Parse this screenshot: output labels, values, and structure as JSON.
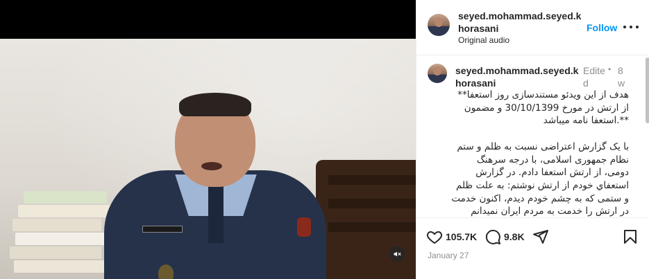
{
  "post": {
    "username": "seyed.mohammad.seyed.khorasani",
    "audio_label": "Original audio",
    "follow_label": "Follow",
    "more_icon": "more-horizontal-icon"
  },
  "caption": {
    "username": "seyed.mohammad.seyed.khorasani",
    "edited_label": "Edited",
    "separator": "•",
    "time_ago": "8w",
    "text": "هدف از این ویدئو مستندسازی روز استعفا** از ارتش در مورخ 30/10/1399 و مضمون **.استعفا نامه میباشد\n\nبا یک گزارش اعتراضی نسبت به ظلم و ستم نظام جمهوری اسلامی، با درجه سرهنگ دومی، از ارتش استعفا دادم. در گزارش استعفاي خودم از ارتش نوشتم: به علت ظلم و ستمی که به چشم خودم دیدم، اکنون خدمت در ارتش را خدمت به مردم ایران نمیدانم"
  },
  "actions": {
    "like_count": "105.7K",
    "comment_count": "9.8K",
    "like_icon": "heart-icon",
    "comment_icon": "comment-icon",
    "share_icon": "share-icon",
    "save_icon": "bookmark-icon"
  },
  "date": "January 27",
  "video": {
    "mute_icon": "muted-speaker-icon"
  },
  "colors": {
    "accent": "#0095f6",
    "text": "#262626",
    "secondary": "#8e8e8e",
    "border": "#efefef"
  }
}
